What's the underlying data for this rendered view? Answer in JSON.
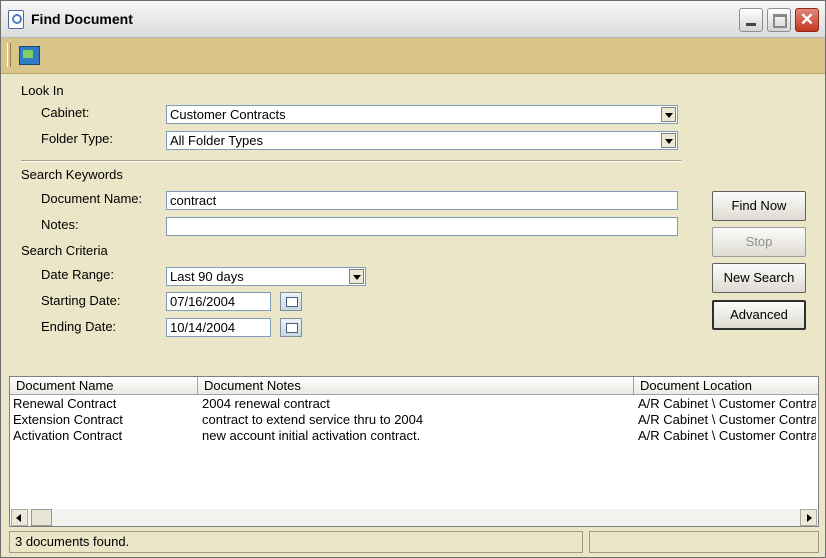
{
  "window": {
    "title": "Find Document"
  },
  "form": {
    "look_in": "Look In",
    "cabinet_label": "Cabinet:",
    "cabinet_value": "Customer Contracts",
    "folder_type_label": "Folder Type:",
    "folder_type_value": "All Folder Types",
    "search_keywords": "Search Keywords",
    "document_name_label": "Document Name:",
    "document_name_value": "contract",
    "notes_label": "Notes:",
    "notes_value": "",
    "search_criteria": "Search Criteria",
    "date_range_label": "Date Range:",
    "date_range_value": "Last 90 days",
    "starting_date_label": "Starting Date:",
    "starting_date_value": "07/16/2004",
    "ending_date_label": "Ending Date:",
    "ending_date_value": "10/14/2004"
  },
  "buttons": {
    "find_now": "Find Now",
    "stop": "Stop",
    "new_search": "New Search",
    "advanced": "Advanced"
  },
  "results": {
    "columns": [
      "Document Name",
      "Document Notes",
      "Document Location"
    ],
    "rows": [
      [
        "Renewal Contract",
        "2004 renewal contract",
        "A/R Cabinet \\ Customer Contra"
      ],
      [
        "Extension Contract",
        "contract to extend service thru to 2004",
        "A/R Cabinet \\ Customer Contra"
      ],
      [
        "Activation Contract",
        "new account initial activation contract.",
        "A/R Cabinet \\ Customer Contra"
      ]
    ]
  },
  "status": {
    "text": "3 documents found."
  },
  "icons": {
    "title": "find-document-icon",
    "toolbar": "app-toolbar-icon",
    "calendar": "calendar-icon"
  }
}
